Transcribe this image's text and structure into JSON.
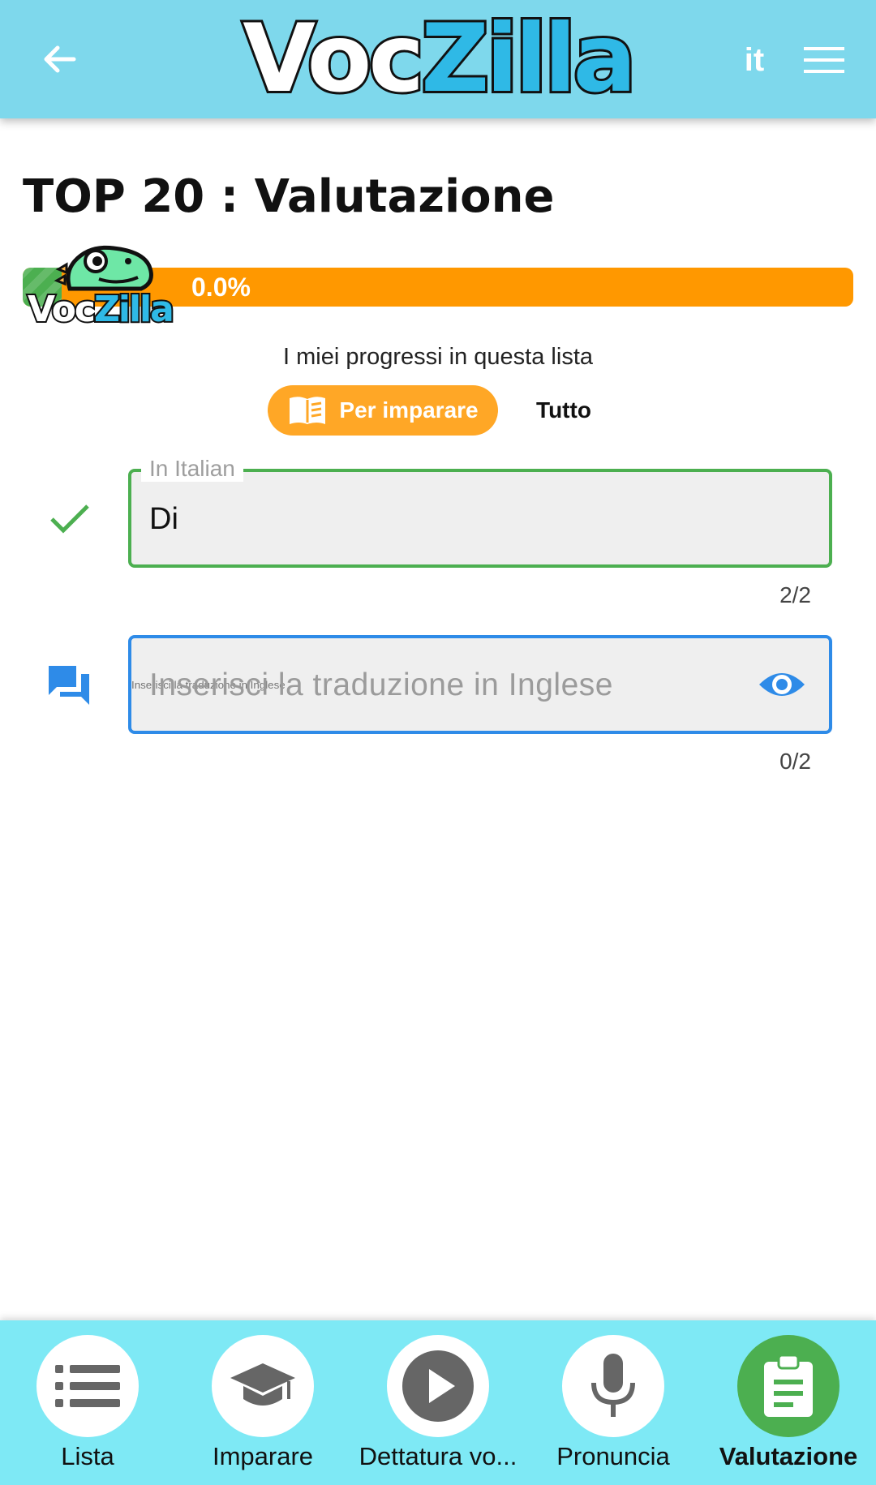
{
  "header": {
    "logo_part1": "Voc",
    "logo_part2": "Zilla",
    "language": "it",
    "colors": {
      "bar": "#7ed8ec",
      "logo_accent": "#2fb9e6"
    },
    "icons": [
      "back-arrow-icon",
      "menu-icon"
    ]
  },
  "page": {
    "title": "TOP 20 : Valutazione"
  },
  "progress": {
    "percent_label": "0.0%",
    "value": 0.0,
    "caption": "I miei progressi in questa lista",
    "mascot_word_part1": "Voc",
    "mascot_word_part2": "Zilla"
  },
  "filter_toggle": {
    "learn_label": "Per imparare",
    "all_label": "Tutto",
    "selected": "Per imparare"
  },
  "source_field": {
    "label": "In Italian",
    "value": "Di",
    "counter": "2/2",
    "status_icon": "check-icon"
  },
  "target_field": {
    "placeholder": "Inserisci la traduzione in Inglese",
    "counter": "0/2",
    "row_icon": "chat-bubbles-icon",
    "action_icon": "eye-icon"
  },
  "bottom_nav": {
    "items": [
      {
        "label": "Lista",
        "icon": "list-icon",
        "active": false
      },
      {
        "label": "Imparare",
        "icon": "graduation-cap-icon",
        "active": false
      },
      {
        "label": "Dettatura vo...",
        "icon": "play-icon",
        "active": false
      },
      {
        "label": "Pronuncia",
        "icon": "microphone-icon",
        "active": false
      },
      {
        "label": "Valutazione",
        "icon": "clipboard-icon",
        "active": true
      }
    ]
  }
}
